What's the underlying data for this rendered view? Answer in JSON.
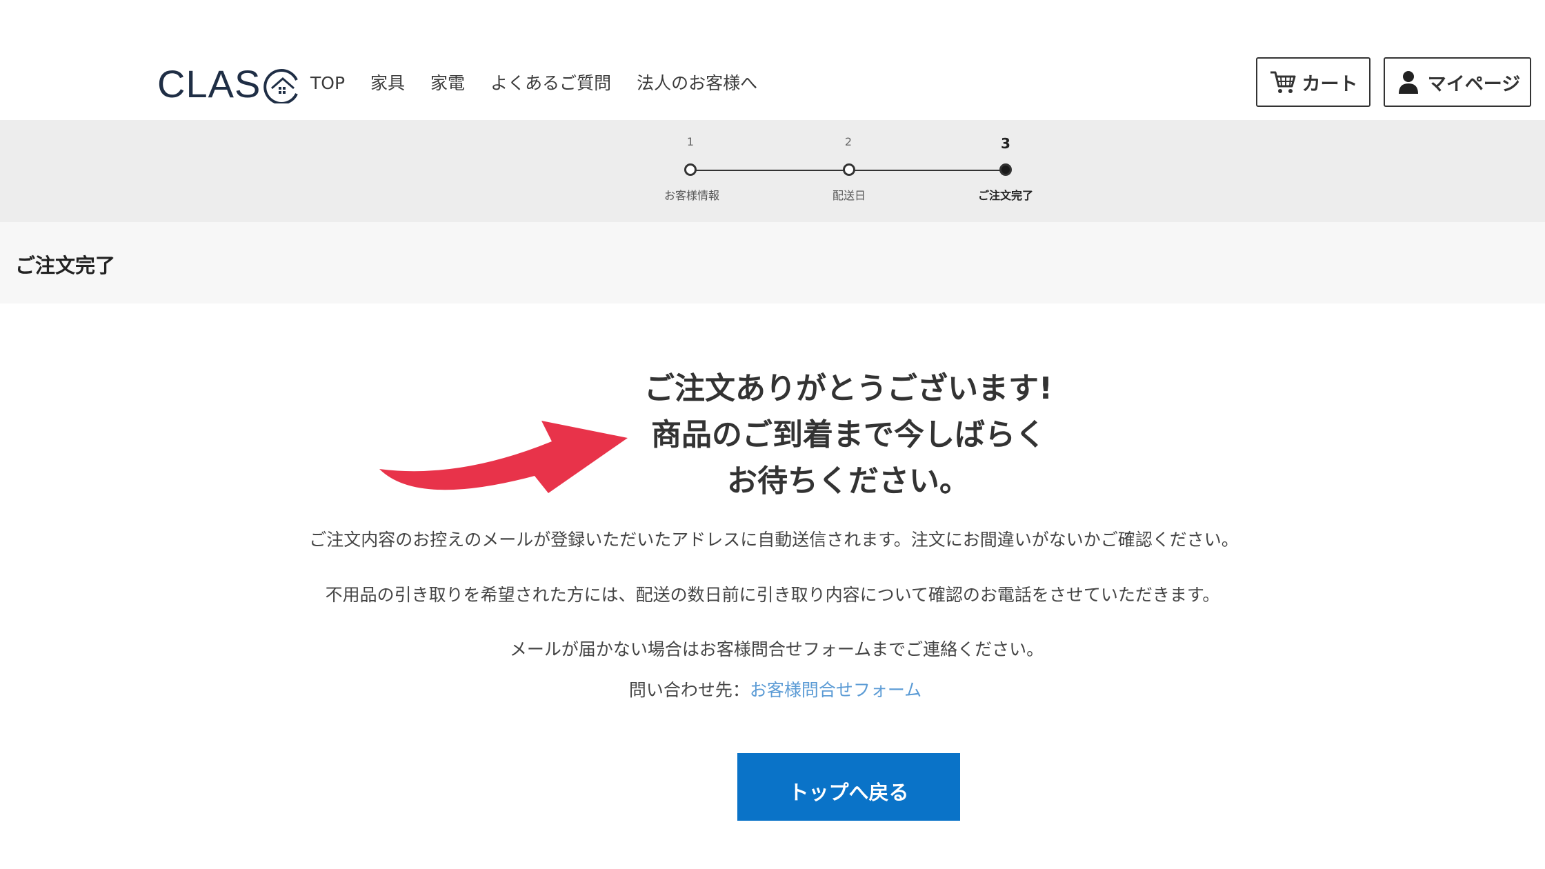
{
  "header": {
    "logo_text": "CLAS",
    "nav": [
      "TOP",
      "家具",
      "家電",
      "よくあるご質問",
      "法人のお客様へ"
    ],
    "cart_label": "カート",
    "mypage_label": "マイページ"
  },
  "steps": [
    {
      "num": "1",
      "label": "お客様情報",
      "active": false
    },
    {
      "num": "2",
      "label": "配送日",
      "active": false
    },
    {
      "num": "3",
      "label": "ご注文完了",
      "active": true
    }
  ],
  "page_title": "ご注文完了",
  "thanks": {
    "line1": "ご注文ありがとうございます!",
    "line2": "商品のご到着まで今しばらく",
    "line3": "お待ちください。"
  },
  "messages": {
    "mail_notice": "ご注文内容のお控えのメールが登録いただいたアドレスに自動送信されます。注文にお間違いがないかご確認ください。",
    "pickup_notice": "不用品の引き取りを希望された方には、配送の数日前に引き取り内容について確認のお電話をさせていただきます。",
    "no_mail_notice": "メールが届かない場合はお客様問合せフォームまでご連絡ください。",
    "contact_prefix": "問い合わせ先：",
    "contact_link": "お客様問合せフォーム"
  },
  "back_to_top_label": "トップへ戻る",
  "colors": {
    "primary_button": "#0a73c8",
    "link": "#5b9bd5",
    "arrow": "#e8334a",
    "logo": "#1f2e45"
  }
}
